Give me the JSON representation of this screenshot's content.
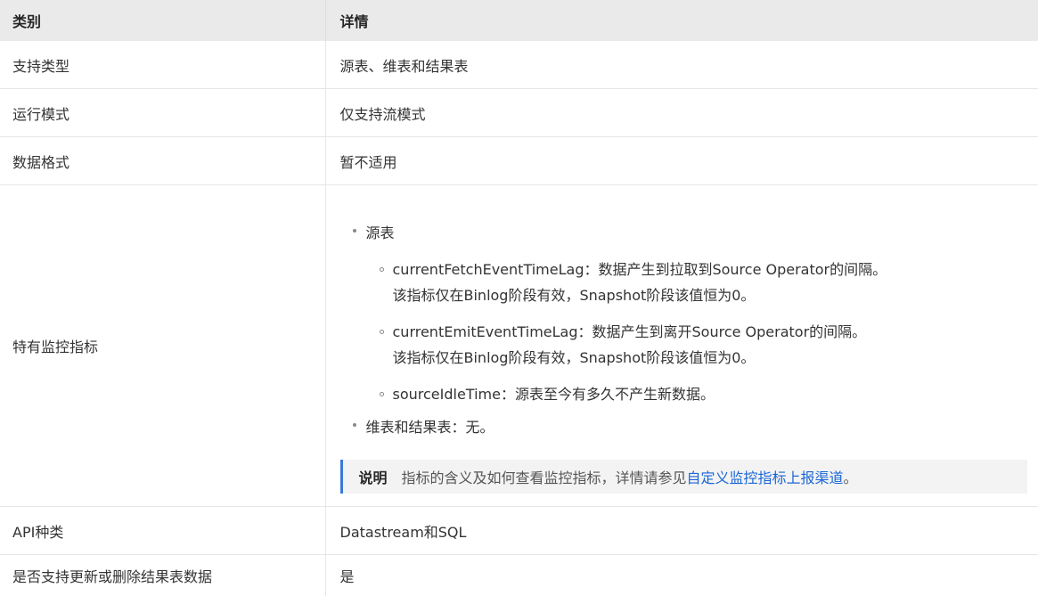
{
  "header": {
    "col1": "类别",
    "col2": "详情"
  },
  "rows": [
    {
      "label": "支持类型",
      "value": "源表、维表和结果表"
    },
    {
      "label": "运行模式",
      "value": "仅支持流模式"
    },
    {
      "label": "数据格式",
      "value": "暂不适用"
    },
    {
      "label": "特有监控指标"
    },
    {
      "label": "API种类",
      "value": "Datastream和SQL"
    },
    {
      "label": "是否支持更新或删除结果表数据",
      "value": "是"
    }
  ],
  "metrics": {
    "source_title": "源表",
    "items": [
      {
        "line1": "currentFetchEventTimeLag：数据产生到拉取到Source Operator的间隔。",
        "line2": "该指标仅在Binlog阶段有效，Snapshot阶段该值恒为0。"
      },
      {
        "line1": "currentEmitEventTimeLag：数据产生到离开Source Operator的间隔。",
        "line2": "该指标仅在Binlog阶段有效，Snapshot阶段该值恒为0。"
      },
      {
        "line1": "sourceIdleTime：源表至今有多久不产生新数据。"
      }
    ],
    "other": "维表和结果表：无。",
    "note": {
      "title": "说明",
      "text": "指标的含义及如何查看监控指标，详情请参见",
      "link": "自定义监控指标上报渠道",
      "end": "。"
    }
  },
  "colors": {
    "header_bg": "#eaeaea",
    "note_border": "#3a78d8",
    "link": "#1a66d6"
  }
}
